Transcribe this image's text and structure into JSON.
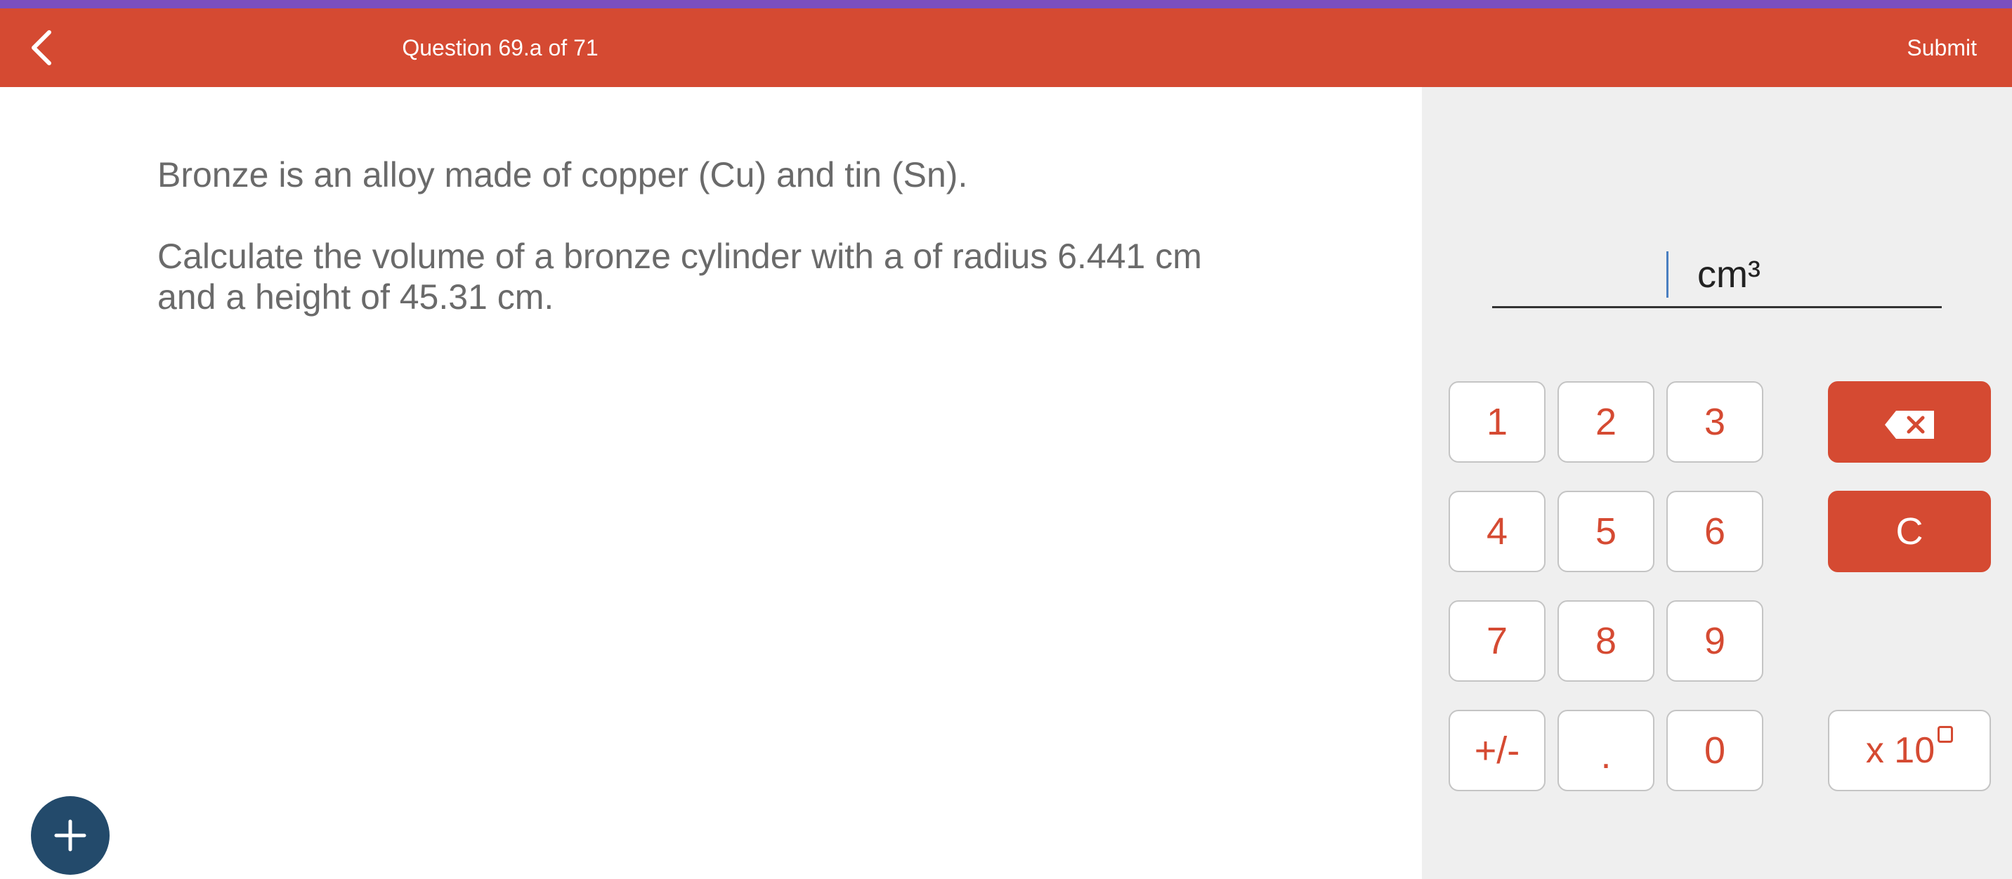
{
  "header": {
    "title": "Question 69.a of 71",
    "submit_label": "Submit"
  },
  "question": {
    "paragraphs": [
      "Bronze is an alloy made of copper (Cu) and tin (Sn).",
      "Calculate the volume of a bronze cylinder with a of radius 6.441 cm and a height of 45.31 cm."
    ]
  },
  "answer": {
    "value": "",
    "unit": "cm³"
  },
  "keypad": {
    "k1": "1",
    "k2": "2",
    "k3": "3",
    "k4": "4",
    "k5": "5",
    "k6": "6",
    "k7": "7",
    "k8": "8",
    "k9": "9",
    "sign": "+/-",
    "dot": ".",
    "k0": "0",
    "clear": "C",
    "exp": "x 10"
  },
  "icons": {
    "back": "chevron-left-icon",
    "backspace": "backspace-icon",
    "add": "plus-icon",
    "exponent_box": "exponent-placeholder-icon"
  },
  "colors": {
    "header_bg": "#d54a32",
    "top_strip": "#7a4fbf",
    "accent": "#d54a32",
    "panel_bg": "#efefef",
    "fab_bg": "#234a6b",
    "cursor": "#4a7fc1"
  }
}
